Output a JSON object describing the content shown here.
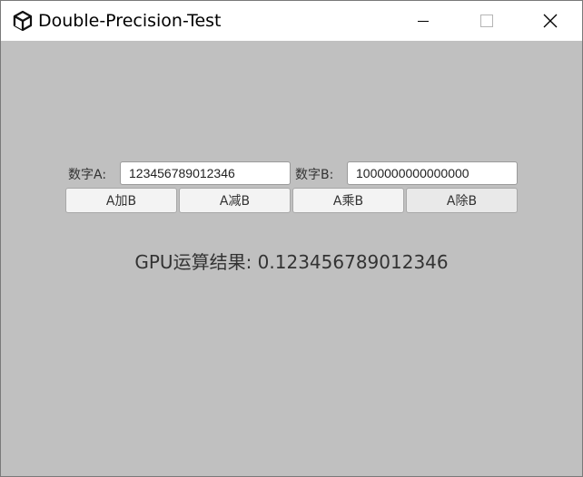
{
  "window": {
    "title": "Double-Precision-Test",
    "icons": {
      "app": "unity-logo-icon",
      "minimize": "minimize-icon",
      "maximize": "maximize-icon",
      "close": "close-icon"
    }
  },
  "form": {
    "a_label": "数字A:",
    "a_value": "123456789012346",
    "b_label": "数字B:",
    "b_value": "1000000000000000"
  },
  "buttons": {
    "add": "A加B",
    "subtract": "A减B",
    "multiply": "A乘B",
    "divide": "A除B"
  },
  "result": {
    "text": "GPU运算结果: 0.123456789012346"
  },
  "colors": {
    "background": "#c0c0c0",
    "titlebar": "#ffffff",
    "button": "#f3f3f3"
  }
}
